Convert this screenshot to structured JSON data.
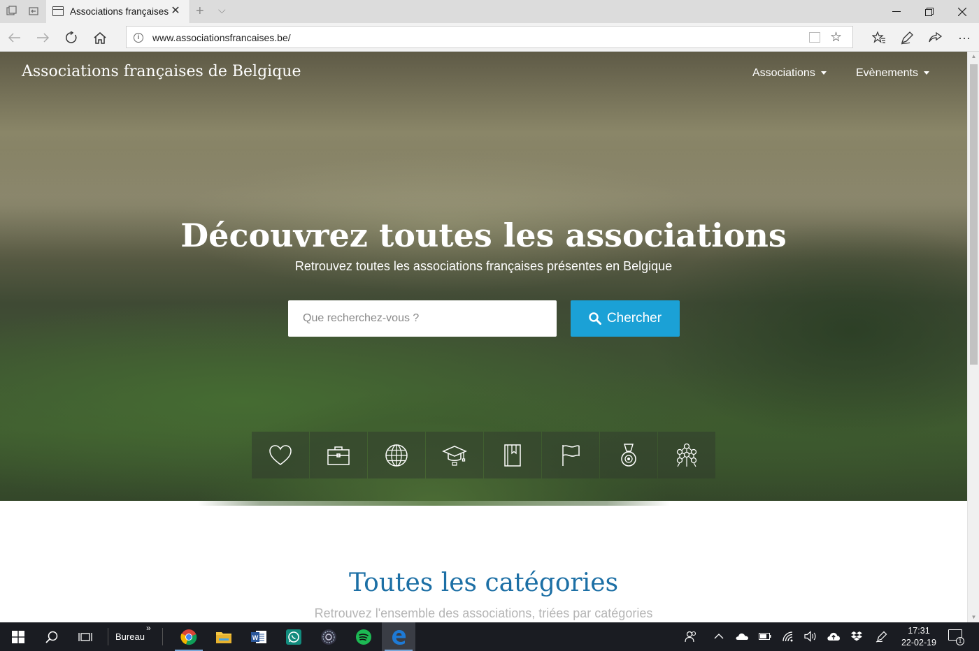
{
  "browser": {
    "tab": {
      "title": "Associations françaises"
    },
    "address": {
      "url": "www.associationsfrancaises.be/"
    }
  },
  "site": {
    "title": "Associations françaises de Belgique",
    "nav": [
      {
        "label": "Associations"
      },
      {
        "label": "Evènements"
      }
    ]
  },
  "hero": {
    "heading": "Découvrez toutes les associations",
    "subheading": "Retrouvez toutes les associations françaises présentes en Belgique",
    "search_placeholder": "Que recherchez-vous ?",
    "search_button": "Chercher",
    "categories": [
      {
        "icon": "heart-icon"
      },
      {
        "icon": "briefcase-icon"
      },
      {
        "icon": "globe-icon"
      },
      {
        "icon": "graduation-cap-icon"
      },
      {
        "icon": "book-icon"
      },
      {
        "icon": "flag-icon"
      },
      {
        "icon": "medal-icon"
      },
      {
        "icon": "atomium-icon"
      }
    ]
  },
  "categories_section": {
    "title": "Toutes les catégories",
    "subtitle": "Retrouvez l'ensemble des associations, triées par catégories"
  },
  "taskbar": {
    "bureau_label": "Bureau",
    "time": "17:31",
    "date": "22-02-19",
    "notification_count": "1"
  }
}
